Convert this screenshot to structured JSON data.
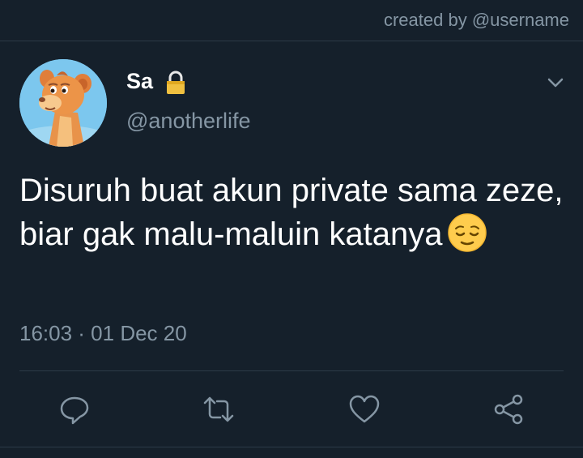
{
  "header": {
    "created_by": "created by @username"
  },
  "tweet": {
    "display_name": "Sa",
    "handle": "@anotherlife",
    "text": "Disuruh buat akun private sama zeze, biar gak malu-maluin katanya",
    "emoji": "relieved-face-icon",
    "timestamp": "16:03 · 01 Dec 20",
    "protected": true
  },
  "icons": {
    "lock": "lock-icon",
    "more": "chevron-down-icon",
    "reply": "reply-icon",
    "retweet": "retweet-icon",
    "like": "heart-icon",
    "share": "share-icon"
  },
  "colors": {
    "background": "#15202b",
    "text_primary": "#ffffff",
    "text_secondary": "#8596a4",
    "divider": "#2c3a47",
    "lock": "#f0c040"
  }
}
